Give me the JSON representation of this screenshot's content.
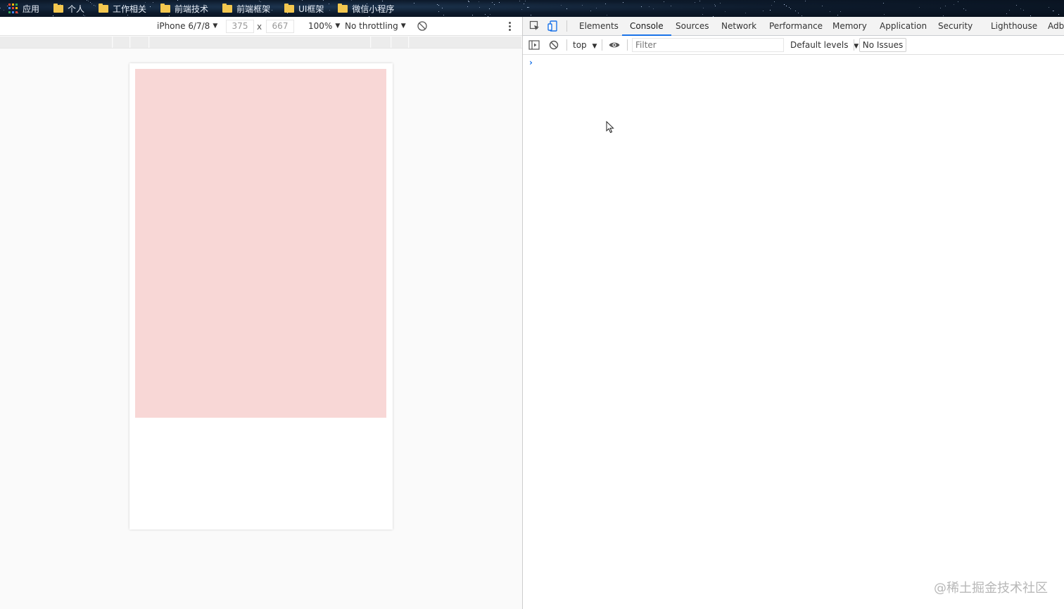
{
  "bookmarks": {
    "items": [
      {
        "label": "应用",
        "icon": "apps-grid-icon"
      },
      {
        "label": "个人",
        "icon": "folder-icon"
      },
      {
        "label": "工作相关",
        "icon": "folder-icon"
      },
      {
        "label": "前端技术",
        "icon": "folder-icon"
      },
      {
        "label": "前端框架",
        "icon": "folder-icon"
      },
      {
        "label": "UI框架",
        "icon": "folder-icon"
      },
      {
        "label": "微信小程序",
        "icon": "folder-icon"
      }
    ]
  },
  "device_toolbar": {
    "device": "iPhone 6/7/8",
    "width": "375",
    "height": "667",
    "separator": "x",
    "zoom": "100%",
    "throttling": "No throttling"
  },
  "devtools": {
    "tabs": [
      "Elements",
      "Console",
      "Sources",
      "Network",
      "Performance",
      "Memory",
      "Application",
      "Security",
      "Lighthouse",
      "Adb"
    ],
    "active_tab": "Console",
    "console_toolbar": {
      "context": "top",
      "filter_placeholder": "Filter",
      "levels": "Default levels",
      "issues": "No Issues"
    },
    "prompt": "›"
  },
  "colors": {
    "pink_box": "#f8d7d6",
    "accent": "#1a73e8"
  },
  "watermark": "@稀土掘金技术社区"
}
